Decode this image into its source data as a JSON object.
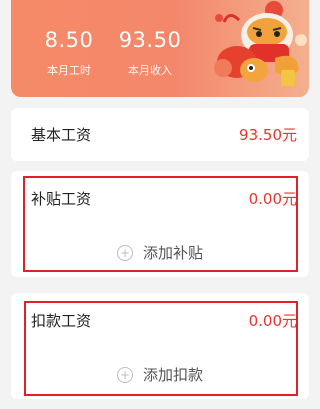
{
  "summary": {
    "hours_value": "8.50",
    "hours_label": "本月工时",
    "income_value": "93.50",
    "income_label": "本月收入"
  },
  "base_salary": {
    "label": "基本工资",
    "amount": "93.50元"
  },
  "allowance": {
    "label": "补贴工资",
    "amount": "0.00元",
    "add_label": "添加补贴"
  },
  "deduction": {
    "label": "扣款工资",
    "amount": "0.00元",
    "add_label": "添加扣款"
  },
  "colors": {
    "accent": "#e8352e",
    "banner": "#f4876a",
    "highlight": "#e0202a"
  },
  "icons": {
    "banner_art": "tiger-fish-festive-illustration",
    "add": "plus-circle-icon"
  }
}
